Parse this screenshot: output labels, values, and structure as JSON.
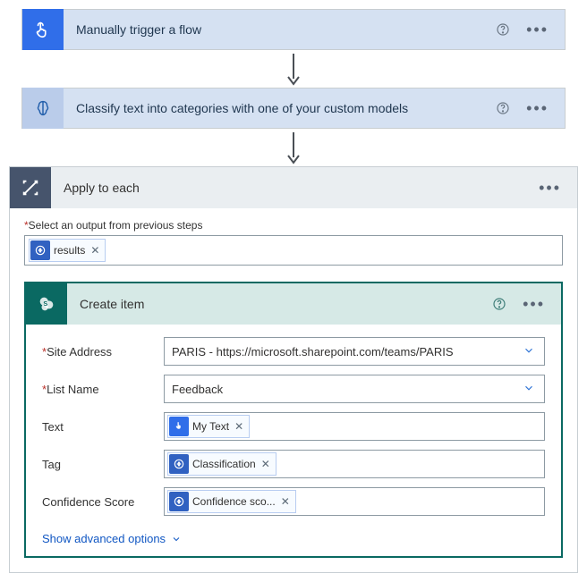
{
  "step1": {
    "title": "Manually trigger a flow"
  },
  "step2": {
    "title": "Classify text into categories with one of your custom models"
  },
  "applyEach": {
    "title": "Apply to each",
    "inputLabel": "Select an output from previous steps",
    "inputToken": "results"
  },
  "createItem": {
    "title": "Create item",
    "fields": {
      "siteAddress": {
        "label": "Site Address",
        "value": "PARIS - https://microsoft.sharepoint.com/teams/PARIS"
      },
      "listName": {
        "label": "List Name",
        "value": "Feedback"
      },
      "text": {
        "label": "Text",
        "token": "My Text"
      },
      "tag": {
        "label": "Tag",
        "token": "Classification"
      },
      "confidence": {
        "label": "Confidence Score",
        "token": "Confidence sco..."
      }
    },
    "advanced": "Show advanced options"
  }
}
